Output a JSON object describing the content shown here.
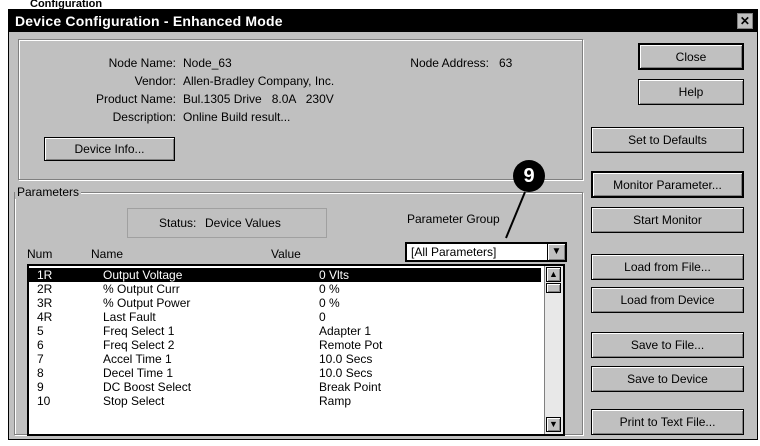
{
  "ghost_caption": "Configuration",
  "window": {
    "title": "Device Configuration - Enhanced Mode",
    "close_glyph": "✕"
  },
  "device": {
    "node_name_label": "Node Name:",
    "node_name": "Node_63",
    "vendor_label": "Vendor:",
    "vendor": "Allen-Bradley Company, Inc.",
    "product_name_label": "Product Name:",
    "product_name": "Bul.1305 Drive   8.0A   230V",
    "description_label": "Description:",
    "description": "Online Build result...",
    "node_address_label": "Node Address:",
    "node_address": "63",
    "device_info_button": "Device Info..."
  },
  "parameters": {
    "group_title": "Parameters",
    "status_label": "Status:",
    "status_value": "Device Values",
    "group_label": "Parameter Group",
    "group_selected": "[All Parameters]",
    "col_num": "Num",
    "col_name": "Name",
    "col_value": "Value",
    "rows": [
      {
        "num": "1R",
        "name": "Output Voltage",
        "value": "0 Vlts"
      },
      {
        "num": "2R",
        "name": "% Output Curr",
        "value": "0 %"
      },
      {
        "num": "3R",
        "name": "% Output Power",
        "value": "0 %"
      },
      {
        "num": "4R",
        "name": "Last Fault",
        "value": "0"
      },
      {
        "num": "5",
        "name": "Freq Select 1",
        "value": "Adapter 1"
      },
      {
        "num": "6",
        "name": "Freq Select 2",
        "value": "Remote Pot"
      },
      {
        "num": "7",
        "name": "Accel Time 1",
        "value": "10.0 Secs"
      },
      {
        "num": "8",
        "name": "Decel Time 1",
        "value": "10.0 Secs"
      },
      {
        "num": "9",
        "name": "DC Boost Select",
        "value": "Break Point"
      },
      {
        "num": "10",
        "name": "Stop Select",
        "value": "Ramp"
      }
    ]
  },
  "buttons": {
    "close": "Close",
    "help": "Help",
    "set_defaults": "Set to Defaults",
    "monitor_parameter": "Monitor Parameter...",
    "start_monitor": "Start Monitor",
    "load_file": "Load from File...",
    "load_device": "Load from Device",
    "save_file": "Save to File...",
    "save_device": "Save to Device",
    "print_text": "Print to Text File..."
  },
  "callout_number": "9"
}
